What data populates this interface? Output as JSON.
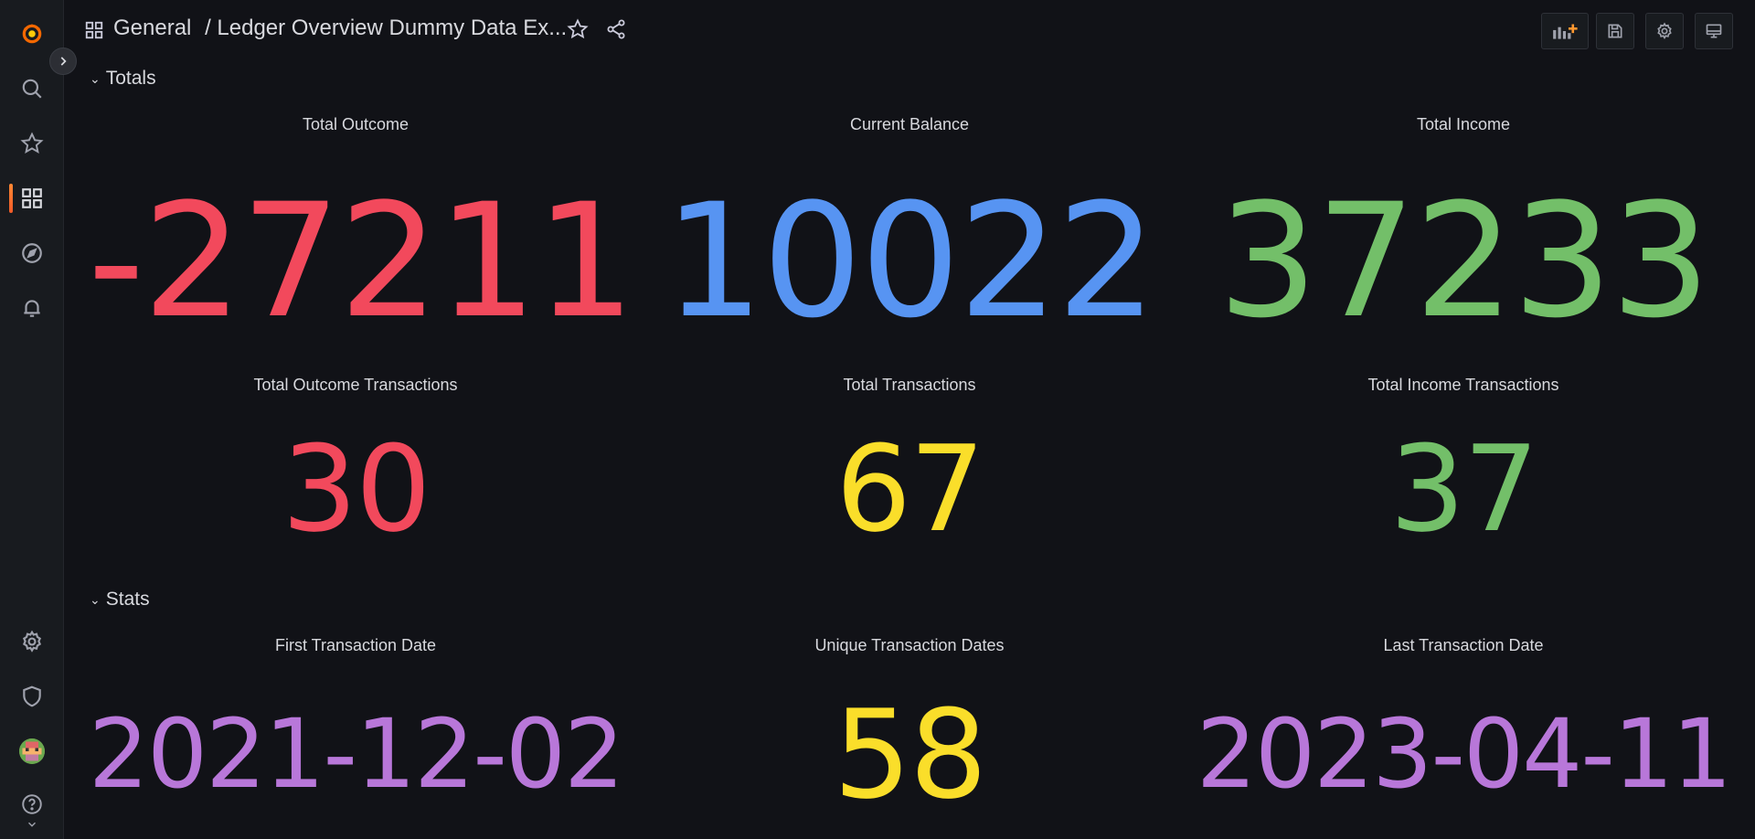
{
  "breadcrumb": {
    "folder": "General",
    "separator": "/",
    "dashboard": "Ledger Overview Dummy Data Ex..."
  },
  "colors": {
    "red": "#f2495c",
    "blue": "#5794f2",
    "green": "#73bf69",
    "yellow": "#fade2a",
    "purple": "#b877d9",
    "accent": "#ff7819"
  },
  "sidebar": {
    "icons": [
      "grafana-logo-icon",
      "search-icon",
      "star-icon",
      "dashboards-icon",
      "explore-icon",
      "alerting-icon",
      "gear-icon",
      "shield-icon",
      "avatar",
      "help-icon"
    ]
  },
  "rows": [
    {
      "title": "Totals",
      "panels": [
        {
          "title": "Total Outcome",
          "value": "-27211",
          "color": "#f2495c"
        },
        {
          "title": "Current Balance",
          "value": "10022",
          "color": "#5794f2"
        },
        {
          "title": "Total Income",
          "value": "37233",
          "color": "#73bf69"
        },
        {
          "title": "Total Outcome Transactions",
          "value": "30",
          "color": "#f2495c"
        },
        {
          "title": "Total Transactions",
          "value": "67",
          "color": "#fade2a"
        },
        {
          "title": "Total Income Transactions",
          "value": "37",
          "color": "#73bf69"
        }
      ]
    },
    {
      "title": "Stats",
      "panels": [
        {
          "title": "First Transaction Date",
          "value": "2021-12-02",
          "color": "#b877d9"
        },
        {
          "title": "Unique Transaction Dates",
          "value": "58",
          "color": "#fade2a"
        },
        {
          "title": "Last Transaction Date",
          "value": "2023-04-11",
          "color": "#b877d9"
        }
      ]
    }
  ]
}
